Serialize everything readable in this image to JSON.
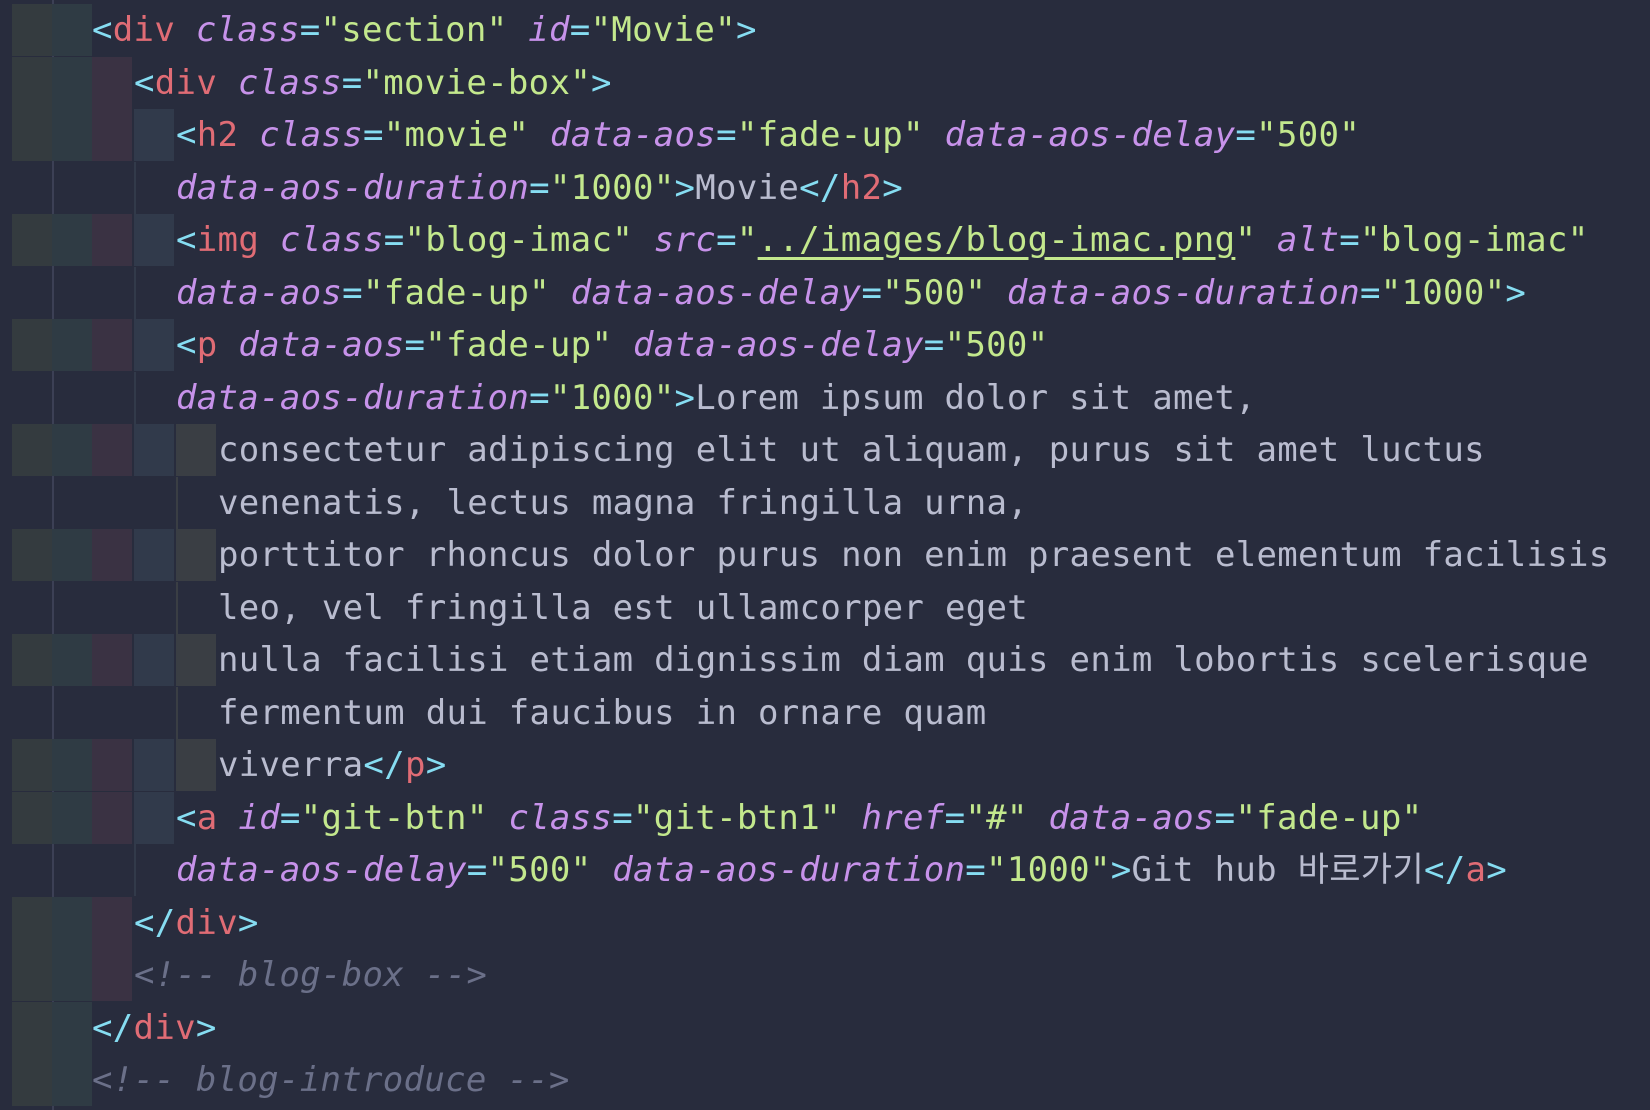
{
  "editor": {
    "lines": [
      {
        "parts": [
          [
            "punc",
            "<"
          ],
          [
            "tag",
            "div"
          ],
          [
            "sp",
            " "
          ],
          [
            "attr",
            "class"
          ],
          [
            "punc",
            "="
          ],
          [
            "str",
            "\"section\""
          ],
          [
            "sp",
            " "
          ],
          [
            "attr",
            "id"
          ],
          [
            "punc",
            "="
          ],
          [
            "str",
            "\"Movie\""
          ],
          [
            "punc",
            ">"
          ]
        ]
      },
      {
        "parts": [
          [
            "punc",
            "<"
          ],
          [
            "tag",
            "div"
          ],
          [
            "sp",
            " "
          ],
          [
            "attr",
            "class"
          ],
          [
            "punc",
            "="
          ],
          [
            "str",
            "\"movie-box\""
          ],
          [
            "punc",
            ">"
          ]
        ]
      },
      {
        "parts": [
          [
            "punc",
            "<"
          ],
          [
            "tag",
            "h2"
          ],
          [
            "sp",
            " "
          ],
          [
            "attr",
            "class"
          ],
          [
            "punc",
            "="
          ],
          [
            "str",
            "\"movie\""
          ],
          [
            "sp",
            " "
          ],
          [
            "attr",
            "data-aos"
          ],
          [
            "punc",
            "="
          ],
          [
            "str",
            "\"fade-up\""
          ],
          [
            "sp",
            " "
          ],
          [
            "attr",
            "data-aos-delay"
          ],
          [
            "punc",
            "="
          ],
          [
            "str",
            "\"500\""
          ]
        ]
      },
      {
        "parts": [
          [
            "attr",
            "data-aos-duration"
          ],
          [
            "punc",
            "="
          ],
          [
            "str",
            "\"1000\""
          ],
          [
            "punc",
            ">"
          ],
          [
            "text",
            "Movie"
          ],
          [
            "punc",
            "</"
          ],
          [
            "tag",
            "h2"
          ],
          [
            "punc",
            ">"
          ]
        ]
      },
      {
        "parts": [
          [
            "punc",
            "<"
          ],
          [
            "tag",
            "img"
          ],
          [
            "sp",
            " "
          ],
          [
            "attr",
            "class"
          ],
          [
            "punc",
            "="
          ],
          [
            "str",
            "\"blog-imac\""
          ],
          [
            "sp",
            " "
          ],
          [
            "attr",
            "src"
          ],
          [
            "punc",
            "="
          ],
          [
            "str",
            "\""
          ],
          [
            "link",
            "../images/blog-imac.png"
          ],
          [
            "str",
            "\""
          ],
          [
            "sp",
            " "
          ],
          [
            "attr",
            "alt"
          ],
          [
            "punc",
            "="
          ],
          [
            "str",
            "\"blog-imac\""
          ]
        ]
      },
      {
        "parts": [
          [
            "attr",
            "data-aos"
          ],
          [
            "punc",
            "="
          ],
          [
            "str",
            "\"fade-up\""
          ],
          [
            "sp",
            " "
          ],
          [
            "attr",
            "data-aos-delay"
          ],
          [
            "punc",
            "="
          ],
          [
            "str",
            "\"500\""
          ],
          [
            "sp",
            " "
          ],
          [
            "attr",
            "data-aos-duration"
          ],
          [
            "punc",
            "="
          ],
          [
            "str",
            "\"1000\""
          ],
          [
            "punc",
            ">"
          ]
        ]
      },
      {
        "parts": [
          [
            "punc",
            "<"
          ],
          [
            "tag",
            "p"
          ],
          [
            "sp",
            " "
          ],
          [
            "attr",
            "data-aos"
          ],
          [
            "punc",
            "="
          ],
          [
            "str",
            "\"fade-up\""
          ],
          [
            "sp",
            " "
          ],
          [
            "attr",
            "data-aos-delay"
          ],
          [
            "punc",
            "="
          ],
          [
            "str",
            "\"500\""
          ]
        ]
      },
      {
        "parts": [
          [
            "attr",
            "data-aos-duration"
          ],
          [
            "punc",
            "="
          ],
          [
            "str",
            "\"1000\""
          ],
          [
            "punc",
            ">"
          ],
          [
            "text",
            "Lorem ipsum dolor sit amet,"
          ]
        ]
      },
      {
        "parts": [
          [
            "text",
            "consectetur adipiscing elit ut aliquam, purus sit amet luctus"
          ]
        ]
      },
      {
        "parts": [
          [
            "text",
            "venenatis, lectus magna fringilla urna,"
          ]
        ]
      },
      {
        "parts": [
          [
            "text",
            "porttitor rhoncus dolor purus non enim praesent elementum facilisis"
          ]
        ]
      },
      {
        "parts": [
          [
            "text",
            "leo, vel fringilla est ullamcorper eget"
          ]
        ]
      },
      {
        "parts": [
          [
            "text",
            "nulla facilisi etiam dignissim diam quis enim lobortis scelerisque"
          ]
        ]
      },
      {
        "parts": [
          [
            "text",
            "fermentum dui faucibus in ornare quam"
          ]
        ]
      },
      {
        "parts": [
          [
            "text",
            "viverra"
          ],
          [
            "punc",
            "</"
          ],
          [
            "tag",
            "p"
          ],
          [
            "punc",
            ">"
          ]
        ]
      },
      {
        "parts": [
          [
            "punc",
            "<"
          ],
          [
            "tag",
            "a"
          ],
          [
            "sp",
            " "
          ],
          [
            "attr",
            "id"
          ],
          [
            "punc",
            "="
          ],
          [
            "str",
            "\"git-btn\""
          ],
          [
            "sp",
            " "
          ],
          [
            "attr",
            "class"
          ],
          [
            "punc",
            "="
          ],
          [
            "str",
            "\"git-btn1\""
          ],
          [
            "sp",
            " "
          ],
          [
            "attr",
            "href"
          ],
          [
            "punc",
            "="
          ],
          [
            "str",
            "\"#\""
          ],
          [
            "sp",
            " "
          ],
          [
            "attr",
            "data-aos"
          ],
          [
            "punc",
            "="
          ],
          [
            "str",
            "\"fade-up\""
          ]
        ]
      },
      {
        "parts": [
          [
            "attr",
            "data-aos-delay"
          ],
          [
            "punc",
            "="
          ],
          [
            "str",
            "\"500\""
          ],
          [
            "sp",
            " "
          ],
          [
            "attr",
            "data-aos-duration"
          ],
          [
            "punc",
            "="
          ],
          [
            "str",
            "\"1000\""
          ],
          [
            "punc",
            ">"
          ],
          [
            "text",
            "Git hub 바로가기"
          ],
          [
            "punc",
            "</"
          ],
          [
            "tag",
            "a"
          ],
          [
            "punc",
            ">"
          ]
        ]
      },
      {
        "parts": [
          [
            "punc",
            "</"
          ],
          [
            "tag",
            "div"
          ],
          [
            "punc",
            ">"
          ]
        ]
      },
      {
        "parts": [
          [
            "cmt",
            "<!-- blog-box -->"
          ]
        ]
      },
      {
        "parts": [
          [
            "punc",
            "</"
          ],
          [
            "tag",
            "div"
          ],
          [
            "punc",
            ">"
          ]
        ]
      },
      {
        "parts": [
          [
            "cmt",
            "<!-- blog-introduce -->"
          ]
        ]
      }
    ]
  },
  "theme": {
    "background": "#282c3d",
    "tag": "#e06c75",
    "punctuation": "#86ddf2",
    "attribute": "#c792ea",
    "string": "#c3e88d",
    "text": "#b9bccf",
    "comment": "#6b7089"
  }
}
